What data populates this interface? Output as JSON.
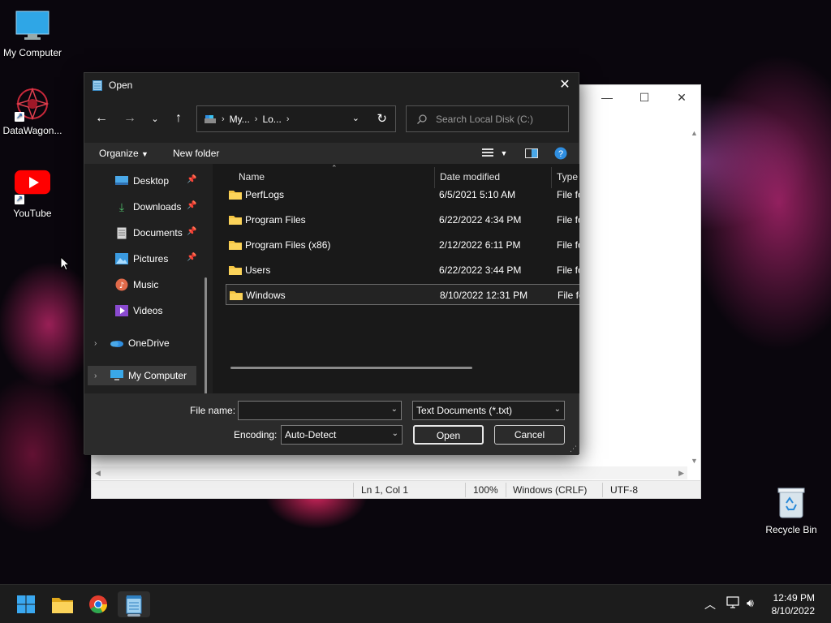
{
  "desktop": {
    "icons": [
      {
        "label": "My Computer",
        "icon": "monitor-icon"
      },
      {
        "label": "DataWagon...",
        "icon": "datawagon-logo-icon"
      },
      {
        "label": "YouTube",
        "icon": "youtube-icon"
      },
      {
        "label": "Recycle Bin",
        "icon": "recycle-bin-icon"
      }
    ]
  },
  "notepad": {
    "status": {
      "position": "Ln 1, Col 1",
      "zoom": "100%",
      "line_ending": "Windows (CRLF)",
      "encoding": "UTF-8"
    }
  },
  "dialog": {
    "title": "Open",
    "breadcrumb": [
      "My...",
      "Lo..."
    ],
    "search_placeholder": "Search Local Disk (C:)",
    "commands": {
      "organize": "Organize",
      "new_folder": "New folder"
    },
    "nav_items": [
      {
        "label": "Desktop",
        "icon": "desktop-icon",
        "pinned": true
      },
      {
        "label": "Downloads",
        "icon": "downloads-icon",
        "pinned": true
      },
      {
        "label": "Documents",
        "icon": "documents-icon",
        "pinned": true
      },
      {
        "label": "Pictures",
        "icon": "pictures-icon",
        "pinned": true
      },
      {
        "label": "Music",
        "icon": "music-icon",
        "pinned": false
      },
      {
        "label": "Videos",
        "icon": "videos-icon",
        "pinned": false
      },
      {
        "label": "OneDrive",
        "icon": "onedrive-icon",
        "pinned": false
      },
      {
        "label": "My Computer",
        "icon": "computer-icon",
        "pinned": false
      }
    ],
    "columns": {
      "name": "Name",
      "date": "Date modified",
      "type": "Type"
    },
    "files": [
      {
        "name": "PerfLogs",
        "date": "6/5/2021 5:10 AM",
        "type": "File fo"
      },
      {
        "name": "Program Files",
        "date": "6/22/2022 4:34 PM",
        "type": "File fo"
      },
      {
        "name": "Program Files (x86)",
        "date": "2/12/2022 6:11 PM",
        "type": "File fo"
      },
      {
        "name": "Users",
        "date": "6/22/2022 3:44 PM",
        "type": "File fo"
      },
      {
        "name": "Windows",
        "date": "8/10/2022 12:31 PM",
        "type": "File fo"
      }
    ],
    "file_name_label": "File name:",
    "file_name_value": "",
    "file_type": "Text Documents (*.txt)",
    "encoding_label": "Encoding:",
    "encoding_value": "Auto-Detect",
    "open_label": "Open",
    "cancel_label": "Cancel"
  },
  "taskbar": {
    "apps": [
      "start-icon",
      "file-explorer-icon",
      "chrome-icon",
      "notepad-icon"
    ],
    "clock": {
      "time": "12:49 PM",
      "date": "8/10/2022"
    }
  }
}
